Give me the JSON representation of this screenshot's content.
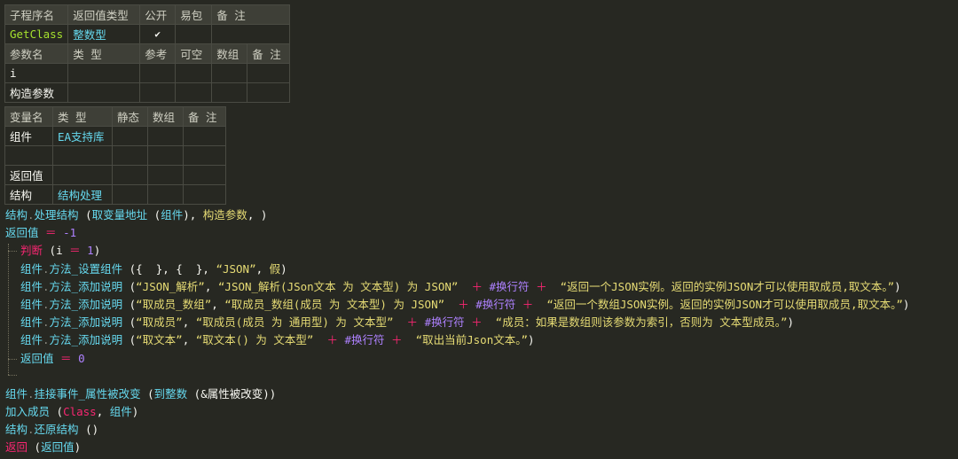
{
  "sub_table": {
    "headers": [
      "子程序名",
      "返回值类型",
      "公开",
      "易包",
      "备 注"
    ],
    "row": {
      "name": "GetClass",
      "return_type": "整数型",
      "public_check": "✔",
      "easy_pkg": "",
      "note": ""
    },
    "param_headers": [
      "参数名",
      "类 型",
      "参考",
      "可空",
      "数组",
      "备 注"
    ],
    "params": [
      {
        "name": "i",
        "type": ""
      },
      {
        "name": "构造参数",
        "type": ""
      }
    ]
  },
  "var_table": {
    "headers": [
      "变量名",
      "类 型",
      "静态",
      "数组",
      "备 注"
    ],
    "rows": [
      {
        "name": "组件",
        "type": "EA支持库"
      },
      {
        "name": "",
        "type": ""
      },
      {
        "name": "返回值",
        "type": ""
      },
      {
        "name": "结构",
        "type": "结构处理"
      }
    ]
  },
  "code": {
    "l1": {
      "a": "结构",
      "b": ".",
      "c": "处理结构",
      "d": " (",
      "e": "取变量地址",
      "f": " (",
      "g": "组件",
      "h": "), ",
      "i": "构造参数",
      "j": ", )"
    },
    "l2": {
      "a": "返回值",
      "b": " ＝ ",
      "c": "-1"
    },
    "l3": {
      "a": "判断",
      "b": " (",
      "c": "i",
      "d": " ＝ ",
      "e": "1",
      "f": ")"
    },
    "l4": {
      "a": "组件",
      "b": ".",
      "c": "方法_设置组件",
      "d": " ({  }, {  }, ",
      "e": "“JSON”",
      "f": ", ",
      "g": "假",
      "h": ")"
    },
    "l5": {
      "a": "组件",
      "b": ".",
      "c": "方法_添加说明",
      "d": " (",
      "e": "“JSON_解析”",
      "f": ", ",
      "g": "“JSON_解析(JSon文本 为 文本型) 为 JSON”",
      "h": "  ＋ ",
      "i": "#换行符",
      "j": " ＋  ",
      "k": "“返回一个JSON实例。返回的实例JSON才可以使用取成员,取文本。”",
      "l": ")"
    },
    "l6": {
      "a": "组件",
      "b": ".",
      "c": "方法_添加说明",
      "d": " (",
      "e": "“取成员_数组”",
      "f": ", ",
      "g": "“取成员_数组(成员 为 文本型) 为 JSON”",
      "h": "  ＋ ",
      "i": "#换行符",
      "j": " ＋  ",
      "k": "“返回一个数组JSON实例。返回的实例JSON才可以使用取成员,取文本。”",
      "l": ")"
    },
    "l7": {
      "a": "组件",
      "b": ".",
      "c": "方法_添加说明",
      "d": " (",
      "e": "“取成员”",
      "f": ", ",
      "g": "“取成员(成员 为 通用型) 为 文本型”",
      "h": "  ＋ ",
      "i": "#换行符",
      "j": " ＋  ",
      "k": "“成员：如果是数组则该参数为索引，否则为 文本型成员。”",
      "l": ")"
    },
    "l8": {
      "a": "组件",
      "b": ".",
      "c": "方法_添加说明",
      "d": " (",
      "e": "“取文本”",
      "f": ", ",
      "g": "“取文本() 为 文本型”",
      "h": "  ＋ ",
      "i": "#换行符",
      "j": " ＋  ",
      "k": "“取出当前Json文本。”",
      "l": ")"
    },
    "l9": {
      "a": "返回值",
      "b": " ＝ ",
      "c": "0"
    },
    "l11": {
      "a": "组件",
      "b": ".",
      "c": "挂接事件_属性被改变",
      "d": " (",
      "e": "到整数",
      "f": " (",
      "g": "&属性被改变",
      "h": "))"
    },
    "l12": {
      "a": "加入成员",
      "b": " (",
      "c": "Class",
      "d": ", ",
      "e": "组件",
      "f": ")"
    },
    "l13": {
      "a": "结构",
      "b": ".",
      "c": "还原结构",
      "d": " ()"
    },
    "l14": {
      "a": "返回",
      "b": " (",
      "c": "返回值",
      "d": ")"
    }
  },
  "colors": {
    "background": "#272822",
    "keyword_red": "#F92672",
    "cmd_cyan": "#66D9EF",
    "string_yellow": "#E6DB74",
    "number_purple": "#AE81FF",
    "green": "#A6E22E"
  }
}
